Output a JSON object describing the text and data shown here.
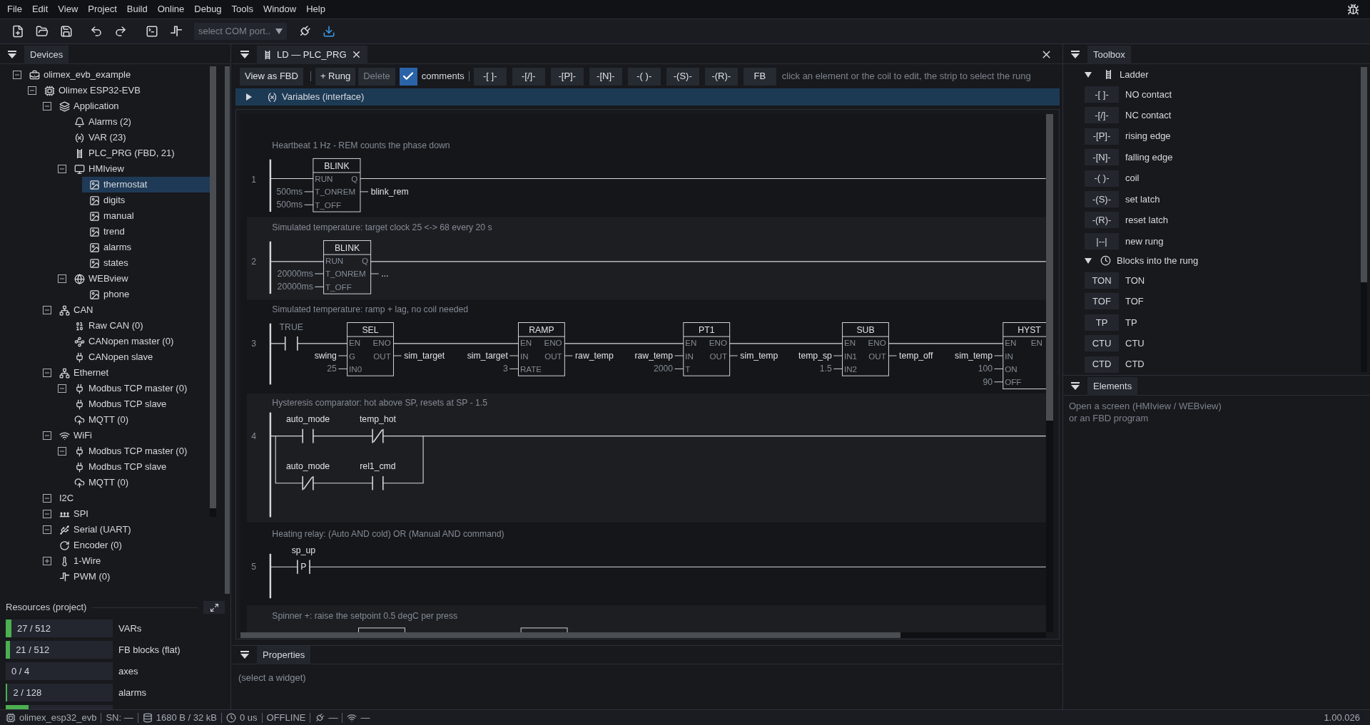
{
  "menu": [
    "File",
    "Edit",
    "View",
    "Project",
    "Build",
    "Online",
    "Debug",
    "Tools",
    "Window",
    "Help"
  ],
  "toolbar": {
    "port_select": {
      "placeholder": "select COM port.."
    }
  },
  "devices_panel": {
    "title": "Devices",
    "tree": [
      {
        "label": "olimex_evb_example",
        "kind": "project",
        "expanded": true,
        "selected": false,
        "children": [
          {
            "label": "Olimex ESP32-EVB",
            "kind": "device",
            "expanded": true,
            "selected": false,
            "children": [
              {
                "label": "Application",
                "kind": "application",
                "expanded": true,
                "selected": false,
                "children": [
                  {
                    "label": "Alarms (2)",
                    "kind": "alarms",
                    "selected": false
                  },
                  {
                    "label": "VAR (23)",
                    "kind": "variables",
                    "selected": false
                  },
                  {
                    "label": "PLC_PRG (FBD, 21)",
                    "kind": "program",
                    "selected": false
                  },
                  {
                    "label": "HMIview",
                    "kind": "hmi",
                    "expanded": true,
                    "selected": false,
                    "children": [
                      {
                        "label": "thermostat",
                        "kind": "screen",
                        "selected": true
                      },
                      {
                        "label": "digits",
                        "kind": "screen",
                        "selected": false
                      },
                      {
                        "label": "manual",
                        "kind": "screen",
                        "selected": false
                      },
                      {
                        "label": "trend",
                        "kind": "screen",
                        "selected": false
                      },
                      {
                        "label": "alarms",
                        "kind": "screen",
                        "selected": false
                      },
                      {
                        "label": "states",
                        "kind": "screen",
                        "selected": false
                      }
                    ]
                  },
                  {
                    "label": "WEBview",
                    "kind": "web",
                    "expanded": true,
                    "selected": false,
                    "children": [
                      {
                        "label": "phone",
                        "kind": "screen",
                        "selected": false
                      }
                    ]
                  }
                ]
              },
              {
                "label": "CAN",
                "kind": "bus",
                "expanded": true,
                "selected": false,
                "children": [
                  {
                    "label": "Raw CAN (0)",
                    "kind": "raw",
                    "selected": false
                  },
                  {
                    "label": "CANopen master (0)",
                    "kind": "master",
                    "selected": false
                  },
                  {
                    "label": "CANopen slave",
                    "kind": "plug",
                    "selected": false
                  }
                ]
              },
              {
                "label": "Ethernet",
                "kind": "bus",
                "expanded": true,
                "selected": false,
                "children": [
                  {
                    "label": "Modbus TCP master (0)",
                    "kind": "plug",
                    "expanded": true,
                    "selected": false
                  },
                  {
                    "label": "Modbus TCP slave",
                    "kind": "plug",
                    "selected": false
                  },
                  {
                    "label": "MQTT (0)",
                    "kind": "mqtt",
                    "selected": false
                  }
                ]
              },
              {
                "label": "WiFi",
                "kind": "wifi",
                "expanded": true,
                "selected": false,
                "children": [
                  {
                    "label": "Modbus TCP master (0)",
                    "kind": "plug",
                    "expanded": true,
                    "selected": false
                  },
                  {
                    "label": "Modbus TCP slave",
                    "kind": "plug",
                    "selected": false
                  },
                  {
                    "label": "MQTT (0)",
                    "kind": "mqtt",
                    "selected": false
                  }
                ]
              },
              {
                "label": "I2C",
                "kind": "plain",
                "expanded": true,
                "selected": false
              },
              {
                "label": "SPI",
                "kind": "spi",
                "expanded": true,
                "selected": false
              },
              {
                "label": "Serial (UART)",
                "kind": "serial",
                "expanded": true,
                "selected": false
              },
              {
                "label": "Encoder (0)",
                "kind": "encoder",
                "selected": false
              },
              {
                "label": "1-Wire",
                "kind": "onewire",
                "expanded": false,
                "selected": false
              },
              {
                "label": "PWM (0)",
                "kind": "pwm",
                "selected": false
              }
            ]
          }
        ]
      }
    ]
  },
  "resources": {
    "title": "Resources (project)",
    "rows": [
      {
        "count": "27 / 512",
        "label": "VARs",
        "level": 0.053
      },
      {
        "count": "21 / 512",
        "label": "FB blocks (flat)",
        "level": 0.041
      },
      {
        "count": "0 / 4",
        "label": "axes",
        "level": 0
      },
      {
        "count": "2 / 128",
        "label": "alarms",
        "level": 0.016
      },
      {
        "level": 0.21
      }
    ]
  },
  "editor": {
    "tab": {
      "title": "LD — PLC_PRG",
      "selected": true
    },
    "toolbar": {
      "buttons": [
        {
          "label": "View as FBD",
          "disabled": false
        },
        {
          "label": "+ Rung",
          "disabled": false
        },
        {
          "label": "Delete",
          "disabled": true
        }
      ],
      "comments": {
        "label": "comments",
        "checked": true
      },
      "elements": [
        "-[ ]-",
        "-[/]-",
        "-[P]-",
        "-[N]-",
        "-( )-",
        "-(S)-",
        "-(R)-",
        "FB"
      ],
      "hint": "click an element or the coil to edit, the strip to select the rung"
    },
    "variables": {
      "label": "Variables (interface)",
      "expanded": false
    },
    "rungs": [
      {
        "number": "1",
        "comment": "Heartbeat 1 Hz - REM counts the phase down",
        "elements": [
          {
            "kind": "block",
            "name": "BLINK",
            "rows": [
              {
                "pin_in": "RUN",
                "pin_out": "Q"
              },
              {
                "constant": "500ms",
                "pin_in": "T_ONREM",
                "output": "blink_rem"
              },
              {
                "constant": "500ms",
                "pin_in": "T_OFF"
              }
            ]
          }
        ]
      },
      {
        "number": "2",
        "comment": "Simulated temperature: target clock 25 <-> 68 every 20 s",
        "elements": [
          {
            "kind": "block",
            "name": "BLINK",
            "rows": [
              {
                "pin_in": "RUN",
                "pin_out": "Q"
              },
              {
                "constant": "20000ms",
                "pin_in": "T_ONREM",
                "output": "..."
              },
              {
                "constant": "20000ms",
                "pin_in": "T_OFF"
              }
            ]
          }
        ]
      },
      {
        "number": "3",
        "comment": "Simulated temperature: ramp + lag, no coil needed",
        "elements": [
          {
            "kind": "no_contact",
            "literal": "TRUE"
          },
          {
            "kind": "block",
            "name": "SEL",
            "rows": [
              {
                "pin_in": "EN",
                "pin_out": "ENO"
              },
              {
                "variable": "swing",
                "pin_in": "G",
                "pin_out": "OUT",
                "output": "sim_target"
              },
              {
                "constant": "25",
                "pin_in": "IN0"
              }
            ]
          },
          {
            "kind": "block",
            "name": "RAMP",
            "rows": [
              {
                "pin_in": "EN",
                "pin_out": "ENO"
              },
              {
                "variable": "sim_target",
                "pin_in": "IN",
                "pin_out": "OUT",
                "output": "raw_temp"
              },
              {
                "constant": "3",
                "pin_in": "RATE"
              }
            ]
          },
          {
            "kind": "block",
            "name": "PT1",
            "rows": [
              {
                "pin_in": "EN",
                "pin_out": "ENO"
              },
              {
                "variable": "raw_temp",
                "pin_in": "IN",
                "pin_out": "OUT",
                "output": "sim_temp"
              },
              {
                "constant": "2000",
                "pin_in": "T"
              }
            ]
          },
          {
            "kind": "block",
            "name": "SUB",
            "rows": [
              {
                "pin_in": "EN",
                "pin_out": "ENO"
              },
              {
                "variable": "temp_sp",
                "pin_in": "IN1",
                "pin_out": "OUT",
                "output": "temp_off"
              },
              {
                "constant": "1.5",
                "pin_in": "IN2"
              }
            ]
          },
          {
            "kind": "block",
            "name": "HYST",
            "rows": [
              {
                "pin_in": "EN",
                "pin_out": "EN"
              },
              {
                "variable": "sim_temp",
                "pin_in": "IN"
              },
              {
                "constant": "100",
                "pin_in": "ON"
              },
              {
                "constant": "90",
                "pin_in": "OFF"
              }
            ]
          }
        ]
      },
      {
        "number": "4",
        "comment": "Hysteresis comparator: hot above SP, resets at SP - 1.5",
        "elements": [
          {
            "kind": "no_contact",
            "variable": "auto_mode"
          },
          {
            "kind": "nc_contact",
            "variable": "temp_hot"
          },
          {
            "kind": "nc_contact",
            "variable": "auto_mode"
          },
          {
            "kind": "no_contact",
            "variable": "rel1_cmd"
          }
        ]
      },
      {
        "number": "5",
        "comment": "Heating relay: (Auto AND cold) OR (Manual AND command)",
        "elements": [
          {
            "kind": "edge_contact",
            "mark": "P",
            "variable": "sp_up"
          }
        ]
      },
      {
        "comment": "Spinner +: raise the setpoint 0.5 degC per press",
        "elements": [
          {
            "kind": "block"
          },
          {
            "kind": "block"
          }
        ]
      }
    ]
  },
  "properties": {
    "title": "Properties",
    "text": "(select a widget)"
  },
  "toolbox": {
    "title": "Toolbox",
    "groups": [
      {
        "label": "Ladder",
        "kind": "ladder",
        "expanded": true,
        "items": [
          {
            "code": "-[ ]-",
            "label": "NO contact"
          },
          {
            "code": "-[/]-",
            "label": "NC contact"
          },
          {
            "code": "-[P]-",
            "label": "rising edge"
          },
          {
            "code": "-[N]-",
            "label": "falling edge"
          },
          {
            "code": "-( )-",
            "label": "coil"
          },
          {
            "code": "-(S)-",
            "label": "set latch"
          },
          {
            "code": "-(R)-",
            "label": "reset latch"
          },
          {
            "code": "|--|",
            "label": "new rung"
          }
        ]
      },
      {
        "label": "Blocks into the rung",
        "kind": "timers",
        "expanded": true,
        "items": [
          {
            "code": "TON",
            "label": "TON"
          },
          {
            "code": "TOF",
            "label": "TOF"
          },
          {
            "code": "TP",
            "label": "TP"
          },
          {
            "code": "CTU",
            "label": "CTU"
          },
          {
            "code": "CTD",
            "label": "CTD"
          }
        ]
      }
    ]
  },
  "elements_panel": {
    "title": "Elements",
    "lines": [
      "Open a screen (HMIview / WEBview)",
      "or an FBD program"
    ]
  },
  "status_bar": {
    "device": "olimex_esp32_evb",
    "serial": "SN: —",
    "memory": "1680 B / 32 kB",
    "cycle": "0 us",
    "connection": "OFFLINE",
    "link": "—",
    "wifi": "—",
    "version": "1.00.026"
  }
}
